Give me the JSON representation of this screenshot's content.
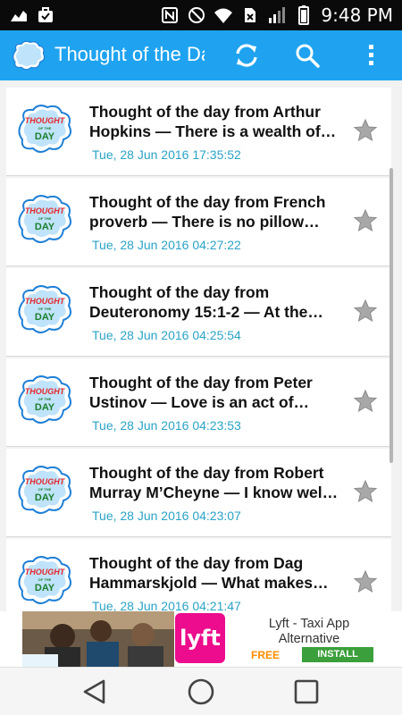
{
  "status_bar": {
    "time": "9:48 PM",
    "icons": [
      "activity-icon",
      "briefcase-icon",
      "nfc-icon",
      "mute-icon",
      "wifi-icon",
      "no-sim-icon",
      "signal-icon",
      "battery-icon"
    ]
  },
  "app_bar": {
    "title": "Thought of the Day",
    "logo_text_line1": "THOUGHT",
    "logo_text_line2": "OF THE",
    "logo_text_line3": "DAY",
    "actions": [
      "refresh-icon",
      "search-icon",
      "more-vert-icon"
    ],
    "color": "#1fa3f0"
  },
  "items": [
    {
      "title": "Thought of the day from Arthur Hopkins — There is a wealth of…",
      "date": "Tue, 28 Jun 2016 17:35:52"
    },
    {
      "title": "Thought of the day from French proverb — There is no pillow…",
      "date": "Tue, 28 Jun 2016 04:27:22"
    },
    {
      "title": "Thought of the day from Deuteronomy 15:1-2 — At the…",
      "date": "Tue, 28 Jun 2016 04:25:54"
    },
    {
      "title": "Thought of the day from Peter Ustinov — Love is an act of…",
      "date": "Tue, 28 Jun 2016 04:23:53"
    },
    {
      "title": "Thought of the day from Robert Murray M’Cheyne — I know wel…",
      "date": "Tue, 28 Jun 2016 04:23:07"
    },
    {
      "title": "Thought of the day from Dag Hammarskjold — What makes…",
      "date": "Tue, 28 Jun 2016 04:21:47"
    }
  ],
  "ad": {
    "logo_text": "lyft",
    "title": "Lyft - Taxi App Alternative",
    "price": "FREE",
    "install_label": "INSTALL"
  },
  "nav_bar": {
    "buttons": [
      "back-icon",
      "home-icon",
      "recents-icon"
    ]
  }
}
